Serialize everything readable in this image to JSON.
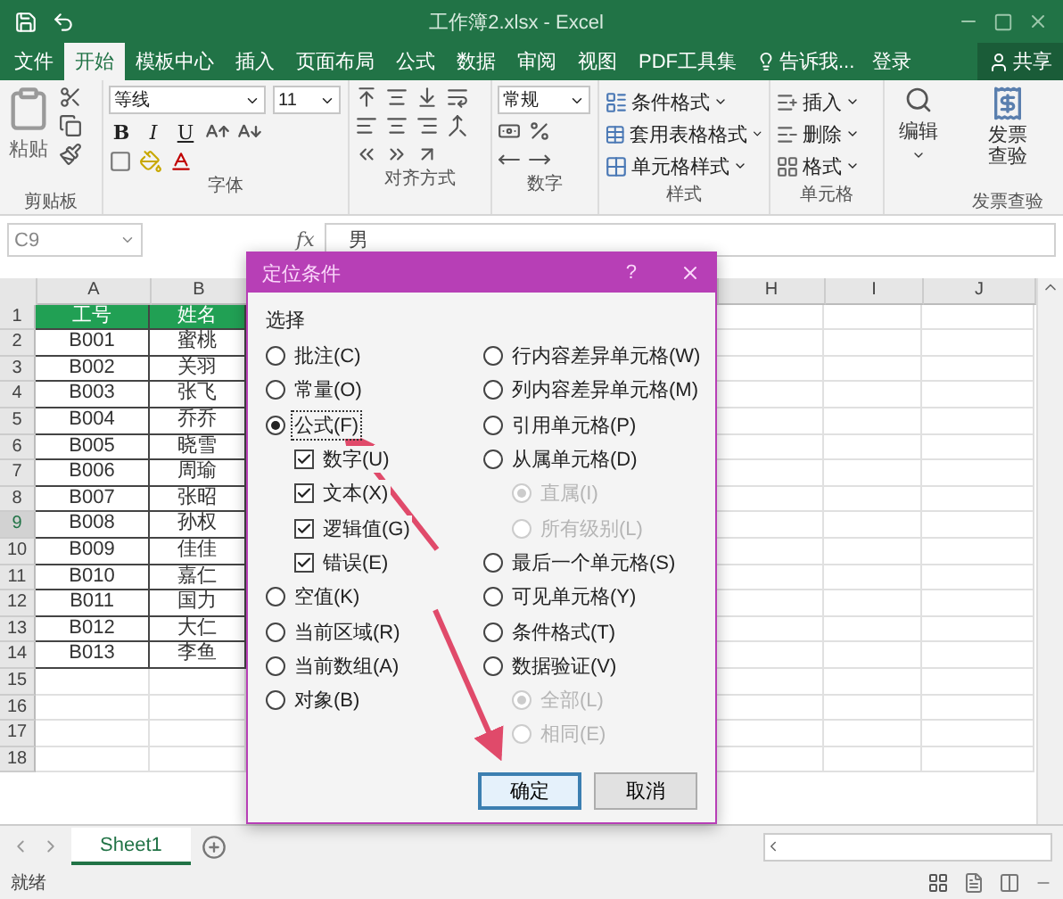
{
  "title_bar": {
    "title": "工作簿2.xlsx - Excel"
  },
  "menu_tabs": [
    {
      "label": "文件",
      "selected": false
    },
    {
      "label": "开始",
      "selected": true
    },
    {
      "label": "模板中心",
      "selected": false
    },
    {
      "label": "插入",
      "selected": false
    },
    {
      "label": "页面布局",
      "selected": false
    },
    {
      "label": "公式",
      "selected": false
    },
    {
      "label": "数据",
      "selected": false
    },
    {
      "label": "审阅",
      "selected": false
    },
    {
      "label": "视图",
      "selected": false
    },
    {
      "label": "PDF工具集",
      "selected": false
    }
  ],
  "tell_me": "告诉我...",
  "login": "登录",
  "share": "共享",
  "ribbon": [
    {
      "kind": "clipboard",
      "label": "剪贴板",
      "button": "粘贴"
    },
    {
      "kind": "font",
      "label": "字体",
      "font_name": "等线",
      "font_size": "11",
      "style_buttons": [
        "B",
        "I",
        "U"
      ]
    },
    {
      "kind": "alignment",
      "label": "对齐方式"
    },
    {
      "kind": "number",
      "label": "数字",
      "format": "常规"
    },
    {
      "kind": "styles",
      "label": "样式",
      "items": [
        "条件格式",
        "套用表格格式",
        "单元格样式"
      ]
    },
    {
      "kind": "cells",
      "label": "单元格",
      "items": [
        "插入",
        "删除",
        "格式"
      ]
    },
    {
      "kind": "editing",
      "button": "编辑"
    },
    {
      "kind": "invoice",
      "label": "发票查验",
      "button": "发票查验"
    }
  ],
  "formula_bar": {
    "name_box": "C9",
    "function_label": "fx",
    "value": "男"
  },
  "grid": {
    "left_columns": [
      "A",
      "B"
    ],
    "right_columns": [
      "H",
      "I",
      "J"
    ],
    "rows": [
      {
        "number": "1",
        "kind": "header",
        "selected": false,
        "cells": [
          "工号",
          "姓名"
        ]
      },
      {
        "number": "2",
        "kind": "data",
        "selected": false,
        "cells": [
          "B001",
          "蜜桃"
        ]
      },
      {
        "number": "3",
        "kind": "data",
        "selected": false,
        "cells": [
          "B002",
          "关羽"
        ]
      },
      {
        "number": "4",
        "kind": "data",
        "selected": false,
        "cells": [
          "B003",
          "张飞"
        ]
      },
      {
        "number": "5",
        "kind": "data",
        "selected": false,
        "cells": [
          "B004",
          "乔乔"
        ]
      },
      {
        "number": "6",
        "kind": "data",
        "selected": false,
        "cells": [
          "B005",
          "晓雪"
        ]
      },
      {
        "number": "7",
        "kind": "data",
        "selected": false,
        "cells": [
          "B006",
          "周瑜"
        ]
      },
      {
        "number": "8",
        "kind": "data",
        "selected": false,
        "cells": [
          "B007",
          "张昭"
        ]
      },
      {
        "number": "9",
        "kind": "data",
        "selected": true,
        "cells": [
          "B008",
          "孙权"
        ]
      },
      {
        "number": "10",
        "kind": "data",
        "selected": false,
        "cells": [
          "B009",
          "佳佳"
        ]
      },
      {
        "number": "11",
        "kind": "data",
        "selected": false,
        "cells": [
          "B010",
          "嘉仁"
        ]
      },
      {
        "number": "12",
        "kind": "data",
        "selected": false,
        "cells": [
          "B011",
          "国力"
        ]
      },
      {
        "number": "13",
        "kind": "data",
        "selected": false,
        "cells": [
          "B012",
          "大仁"
        ]
      },
      {
        "number": "14",
        "kind": "data",
        "selected": false,
        "cells": [
          "B013",
          "李鱼"
        ]
      },
      {
        "number": "15",
        "kind": "empty",
        "selected": false,
        "cells": []
      },
      {
        "number": "16",
        "kind": "empty",
        "selected": false,
        "cells": []
      },
      {
        "number": "17",
        "kind": "empty",
        "selected": false,
        "cells": []
      },
      {
        "number": "18",
        "kind": "empty",
        "selected": false,
        "cells": []
      }
    ]
  },
  "dialog": {
    "title": "定位条件",
    "help": "?",
    "section": "选择",
    "left_options": [
      {
        "kind": "radio",
        "label": "批注(C)",
        "selected": false,
        "focused": false
      },
      {
        "kind": "radio",
        "label": "常量(O)",
        "selected": false,
        "focused": false
      },
      {
        "kind": "radio",
        "label": "公式(F)",
        "selected": true,
        "focused": true
      },
      {
        "kind": "checkbox",
        "label": "数字(U)",
        "checked": true
      },
      {
        "kind": "checkbox",
        "label": "文本(X)",
        "checked": true
      },
      {
        "kind": "checkbox",
        "label": "逻辑值(G)",
        "checked": true
      },
      {
        "kind": "checkbox",
        "label": "错误(E)",
        "checked": true
      },
      {
        "kind": "radio",
        "label": "空值(K)",
        "selected": false,
        "focused": false
      },
      {
        "kind": "radio",
        "label": "当前区域(R)",
        "selected": false,
        "focused": false
      },
      {
        "kind": "radio",
        "label": "当前数组(A)",
        "selected": false,
        "focused": false
      },
      {
        "kind": "radio",
        "label": "对象(B)",
        "selected": false,
        "focused": false
      }
    ],
    "right_options": [
      {
        "kind": "radio",
        "label": "行内容差异单元格(W)",
        "selected": false,
        "disabled": false
      },
      {
        "kind": "radio",
        "label": "列内容差异单元格(M)",
        "selected": false,
        "disabled": false
      },
      {
        "kind": "radio",
        "label": "引用单元格(P)",
        "selected": false,
        "disabled": false
      },
      {
        "kind": "radio",
        "label": "从属单元格(D)",
        "selected": false,
        "disabled": false
      },
      {
        "kind": "subradio",
        "label": "直属(I)",
        "selected": true,
        "disabled": true
      },
      {
        "kind": "subradio",
        "label": "所有级别(L)",
        "selected": false,
        "disabled": true
      },
      {
        "kind": "radio",
        "label": "最后一个单元格(S)",
        "selected": false,
        "disabled": false
      },
      {
        "kind": "radio",
        "label": "可见单元格(Y)",
        "selected": false,
        "disabled": false
      },
      {
        "kind": "radio",
        "label": "条件格式(T)",
        "selected": false,
        "disabled": false
      },
      {
        "kind": "radio",
        "label": "数据验证(V)",
        "selected": false,
        "disabled": false
      },
      {
        "kind": "subradio",
        "label": "全部(L)",
        "selected": true,
        "disabled": true
      },
      {
        "kind": "subradio",
        "label": "相同(E)",
        "selected": false,
        "disabled": true
      }
    ],
    "buttons": [
      {
        "label": "确定",
        "default": true
      },
      {
        "label": "取消",
        "default": false
      }
    ]
  },
  "sheet_tabs": [
    {
      "label": "Sheet1",
      "selected": true
    }
  ],
  "status": "就绪"
}
